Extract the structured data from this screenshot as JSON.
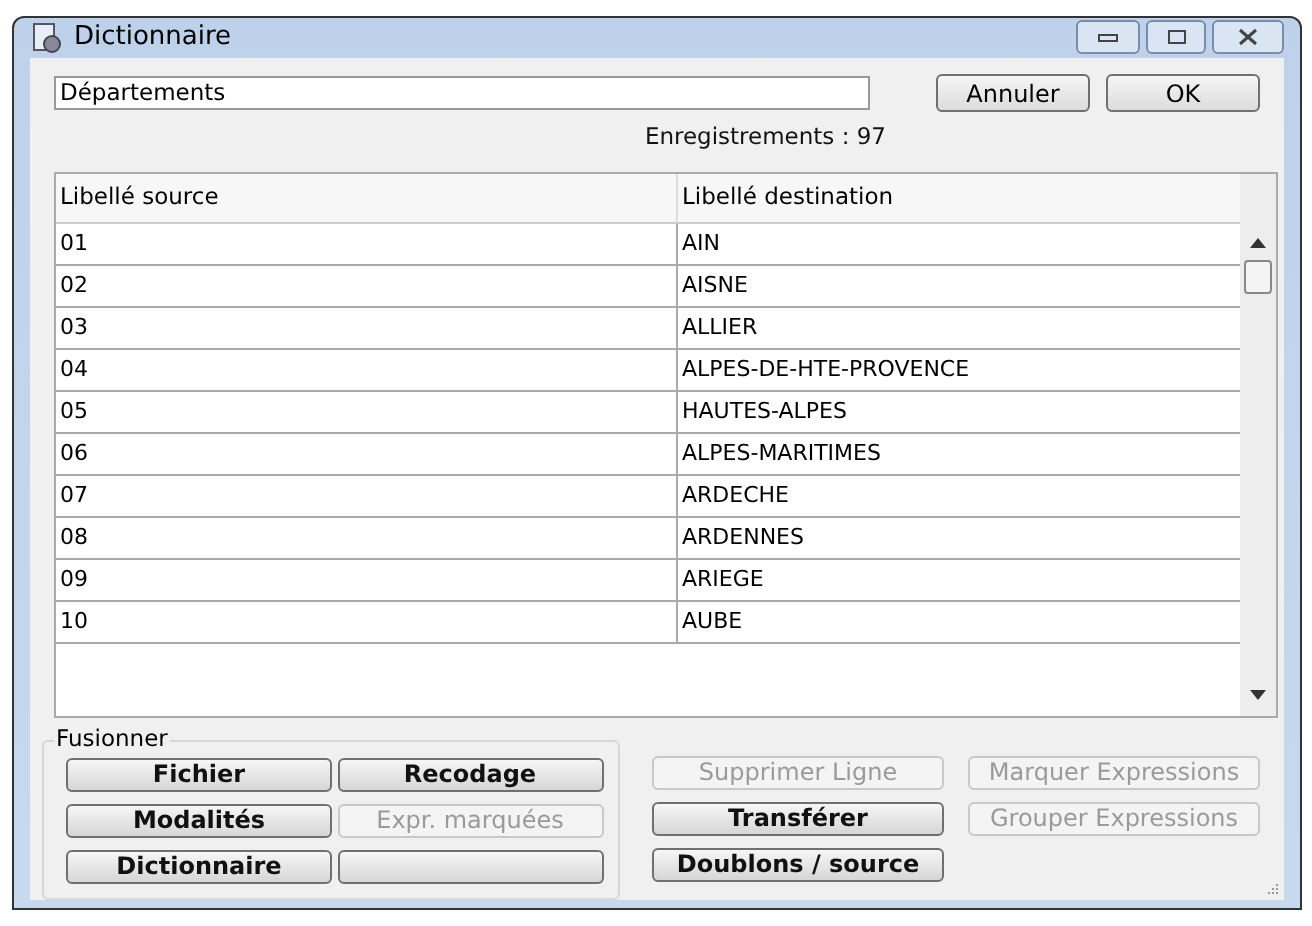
{
  "window": {
    "title": "Dictionnaire"
  },
  "name_field": {
    "value": "Départements"
  },
  "top_buttons": [
    {
      "label": "Annuler"
    },
    {
      "label": "OK"
    }
  ],
  "record_count": "Enregistrements : 97",
  "table": {
    "columns": [
      "Libellé source",
      "Libellé destination"
    ],
    "rows": [
      [
        "01",
        "AIN"
      ],
      [
        "02",
        "AISNE"
      ],
      [
        "03",
        "ALLIER"
      ],
      [
        "04",
        "ALPES-DE-HTE-PROVENCE"
      ],
      [
        "05",
        "HAUTES-ALPES"
      ],
      [
        "06",
        "ALPES-MARITIMES"
      ],
      [
        "07",
        "ARDECHE"
      ],
      [
        "08",
        "ARDENNES"
      ],
      [
        "09",
        "ARIEGE"
      ],
      [
        "10",
        "AUBE"
      ]
    ]
  },
  "merge_group": {
    "title": "Fusionner",
    "buttons": [
      {
        "label": "Fichier",
        "disabled": false
      },
      {
        "label": "Recodage",
        "disabled": false
      },
      {
        "label": "Modalités",
        "disabled": false
      },
      {
        "label": "Expr. marquées",
        "disabled": true
      },
      {
        "label": "Dictionnaire",
        "disabled": false
      },
      {
        "disabled": false
      }
    ]
  },
  "action_buttons": [
    {
      "label": "Supprimer Ligne",
      "disabled": true
    },
    {
      "label": "Marquer Expressions",
      "disabled": true
    },
    {
      "label": "Transférer",
      "disabled": false
    },
    {
      "label": "Grouper Expressions",
      "disabled": true
    },
    {
      "label": "Doublons / source",
      "disabled": false
    }
  ]
}
